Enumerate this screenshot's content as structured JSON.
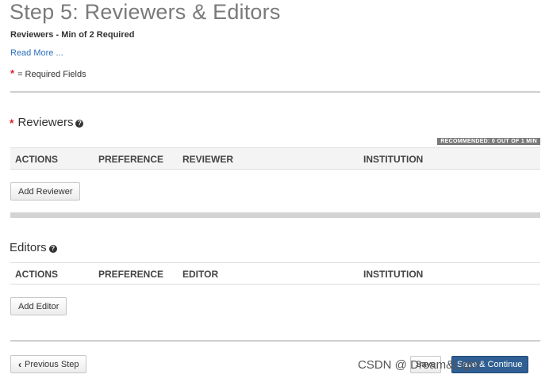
{
  "page": {
    "title": "Step 5: Reviewers & Editors",
    "subtitle": "Reviewers - Min of 2 Required",
    "read_more": "Read More ...",
    "required_star": "*",
    "required_note": "= Required Fields"
  },
  "reviewers": {
    "star": "*",
    "title": "Reviewers",
    "help_glyph": "?",
    "badge": "RECOMMENDED: 0 OUT OF 1 MIN",
    "columns": [
      "ACTIONS",
      "PREFERENCE",
      "REVIEWER",
      "INSTITUTION"
    ],
    "add_button": "Add Reviewer"
  },
  "editors": {
    "title": "Editors",
    "help_glyph": "?",
    "columns": [
      "ACTIONS",
      "PREFERENCE",
      "EDITOR",
      "INSTITUTION"
    ],
    "add_button": "Add Editor"
  },
  "footer": {
    "prev_chevron": "‹",
    "prev_button": "Previous Step",
    "save_button": "Save",
    "save_continue_button": "Save & Continue",
    "watermark": "CSDN @ Dream&Light"
  },
  "colors": {
    "accent_link": "#2a6ebb",
    "required_star": "#d9232d",
    "primary_button": "#2f5f93",
    "badge_bg": "#7b7b7b"
  },
  "icons": {
    "help": "question-circle-icon",
    "previous": "chevron-left-icon"
  }
}
